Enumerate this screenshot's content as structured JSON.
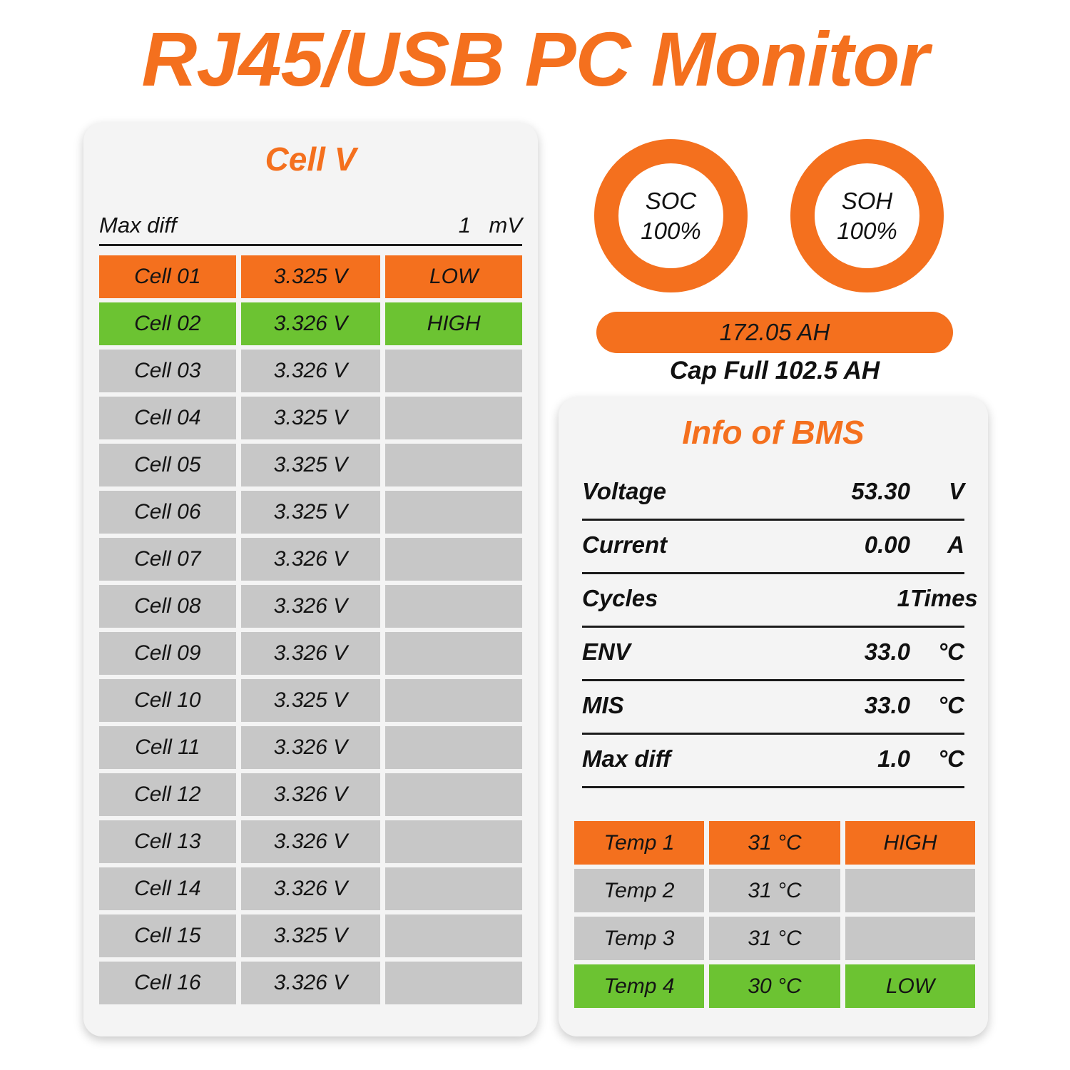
{
  "app": {
    "title": "RJ45/USB PC Monitor",
    "accent_color": "#F4701E",
    "high_color": "#6CC332",
    "neutral_color": "#C7C7C7",
    "card_color": "#F4F4F4"
  },
  "cell_panel": {
    "title": "Cell V",
    "max_diff": {
      "label": "Max diff",
      "value": "1",
      "unit": "mV"
    },
    "rows": [
      {
        "name": "Cell 01",
        "value": "3.325 V",
        "flag": "LOW",
        "state": "low"
      },
      {
        "name": "Cell 02",
        "value": "3.326 V",
        "flag": "HIGH",
        "state": "high"
      },
      {
        "name": "Cell 03",
        "value": "3.326 V",
        "flag": "",
        "state": "normal"
      },
      {
        "name": "Cell 04",
        "value": "3.325 V",
        "flag": "",
        "state": "normal"
      },
      {
        "name": "Cell 05",
        "value": "3.325 V",
        "flag": "",
        "state": "normal"
      },
      {
        "name": "Cell 06",
        "value": "3.325 V",
        "flag": "",
        "state": "normal"
      },
      {
        "name": "Cell 07",
        "value": "3.326 V",
        "flag": "",
        "state": "normal"
      },
      {
        "name": "Cell 08",
        "value": "3.326 V",
        "flag": "",
        "state": "normal"
      },
      {
        "name": "Cell 09",
        "value": "3.326 V",
        "flag": "",
        "state": "normal"
      },
      {
        "name": "Cell 10",
        "value": "3.325 V",
        "flag": "",
        "state": "normal"
      },
      {
        "name": "Cell 11",
        "value": "3.326 V",
        "flag": "",
        "state": "normal"
      },
      {
        "name": "Cell 12",
        "value": "3.326 V",
        "flag": "",
        "state": "normal"
      },
      {
        "name": "Cell 13",
        "value": "3.326 V",
        "flag": "",
        "state": "normal"
      },
      {
        "name": "Cell 14",
        "value": "3.326 V",
        "flag": "",
        "state": "normal"
      },
      {
        "name": "Cell 15",
        "value": "3.325 V",
        "flag": "",
        "state": "normal"
      },
      {
        "name": "Cell 16",
        "value": "3.326 V",
        "flag": "",
        "state": "normal"
      }
    ]
  },
  "gauges": {
    "soc": {
      "label": "SOC",
      "value": "100%"
    },
    "soh": {
      "label": "SOH",
      "value": "100%"
    }
  },
  "capacity": {
    "remaining": "172.05 AH",
    "full": "Cap Full 102.5 AH"
  },
  "bms_panel": {
    "title": "Info of BMS",
    "rows": [
      {
        "label": "Voltage",
        "value": "53.30",
        "unit": "V"
      },
      {
        "label": "Current",
        "value": "0.00",
        "unit": "A"
      },
      {
        "label": "Cycles",
        "value": "1",
        "unit": "Times"
      },
      {
        "label": "ENV",
        "value": "33.0",
        "unit": "°C"
      },
      {
        "label": "MIS",
        "value": "33.0",
        "unit": "°C"
      },
      {
        "label": "Max diff",
        "value": "1.0",
        "unit": "°C"
      }
    ],
    "temps": [
      {
        "name": "Temp 1",
        "value": "31 °C",
        "flag": "HIGH",
        "state": "high"
      },
      {
        "name": "Temp 2",
        "value": "31 °C",
        "flag": "",
        "state": "normal"
      },
      {
        "name": "Temp 3",
        "value": "31 °C",
        "flag": "",
        "state": "normal"
      },
      {
        "name": "Temp 4",
        "value": "30 °C",
        "flag": "LOW",
        "state": "low"
      }
    ]
  }
}
